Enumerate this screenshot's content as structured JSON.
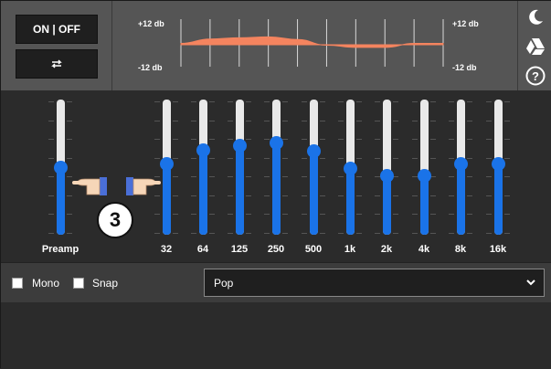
{
  "controls": {
    "power_label": "ON | OFF",
    "loop_icon": "repeat-icon",
    "loop_glyph": "⇄"
  },
  "curve": {
    "top_left_db": "+12 db",
    "bottom_left_db": "-12 db",
    "top_right_db": "+12 db",
    "bottom_right_db": "-12 db"
  },
  "side_icons": [
    "moon-icon",
    "drive-icon",
    "help-icon"
  ],
  "help_glyph": "?",
  "preamp": {
    "label": "Preamp",
    "level": 0.5
  },
  "bands": [
    {
      "label": "32",
      "level": 0.53
    },
    {
      "label": "64",
      "level": 0.63
    },
    {
      "label": "125",
      "level": 0.66
    },
    {
      "label": "250",
      "level": 0.68
    },
    {
      "label": "500",
      "level": 0.62
    },
    {
      "label": "1k",
      "level": 0.49
    },
    {
      "label": "2k",
      "level": 0.44
    },
    {
      "label": "4k",
      "level": 0.44
    },
    {
      "label": "8k",
      "level": 0.53
    },
    {
      "label": "16k",
      "level": 0.53
    }
  ],
  "options": {
    "mono_label": "Mono",
    "snap_label": "Snap",
    "mono_checked": false,
    "snap_checked": false
  },
  "preset": {
    "selected": "Pop"
  },
  "annotation": {
    "step_number": "3"
  },
  "colors": {
    "accent": "#1a73e8",
    "curve_fill": "#f4845f"
  }
}
